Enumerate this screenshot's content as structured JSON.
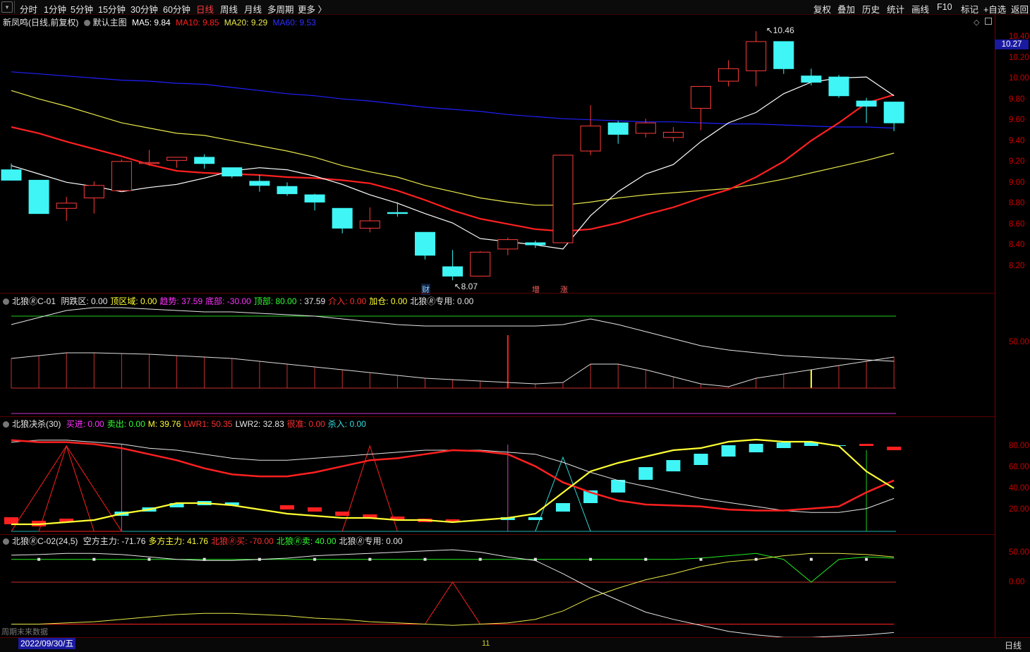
{
  "toolbar": {
    "periods": [
      "分时",
      "1分钟",
      "5分钟",
      "15分钟",
      "30分钟",
      "60分钟",
      "日线",
      "周线",
      "月线",
      "多周期",
      "更多 〉"
    ],
    "active": "日线",
    "right_buttons": [
      "复权",
      "叠加",
      "历史",
      "统计",
      "画线",
      "F10",
      "标记",
      "+自选",
      "返回"
    ]
  },
  "main_legend": {
    "title": "新凤鸣(日线,前复权)",
    "layer": "默认主图",
    "ma5": "MA5: 9.84",
    "ma10": "MA10: 9.85",
    "ma20": "MA20: 9.29",
    "ma60": "MA60: 9.53"
  },
  "price_axis": [
    "10.40",
    "10.20",
    "10.00",
    "9.80",
    "9.60",
    "9.40",
    "9.20",
    "9.00",
    "8.80",
    "8.60",
    "8.40",
    "8.20"
  ],
  "price_axis_range": [
    8.07,
    10.46
  ],
  "last_price": "10.27",
  "high_label": "10.46",
  "low_label": "8.07",
  "events": [
    "财",
    "增",
    "涨"
  ],
  "candles": [
    {
      "o": 9.13,
      "h": 9.19,
      "l": 9.04,
      "c": 9.03
    },
    {
      "o": 9.03,
      "h": 9.03,
      "l": 8.71,
      "c": 8.71
    },
    {
      "o": 8.76,
      "h": 8.87,
      "l": 8.64,
      "c": 8.81
    },
    {
      "o": 8.86,
      "h": 9.02,
      "l": 8.71,
      "c": 8.98
    },
    {
      "o": 8.93,
      "h": 9.23,
      "l": 8.92,
      "c": 9.21
    },
    {
      "o": 9.2,
      "h": 9.32,
      "l": 9.17,
      "c": 9.2
    },
    {
      "o": 9.22,
      "h": 9.25,
      "l": 9.15,
      "c": 9.25
    },
    {
      "o": 9.25,
      "h": 9.28,
      "l": 9.14,
      "c": 9.19
    },
    {
      "o": 9.15,
      "h": 9.15,
      "l": 9.05,
      "c": 9.07
    },
    {
      "o": 9.02,
      "h": 9.08,
      "l": 8.92,
      "c": 8.98
    },
    {
      "o": 8.97,
      "h": 9.01,
      "l": 8.88,
      "c": 8.9
    },
    {
      "o": 8.89,
      "h": 8.9,
      "l": 8.74,
      "c": 8.82
    },
    {
      "o": 8.76,
      "h": 8.76,
      "l": 8.52,
      "c": 8.57
    },
    {
      "o": 8.57,
      "h": 8.77,
      "l": 8.53,
      "c": 8.64
    },
    {
      "o": 8.72,
      "h": 8.82,
      "l": 8.68,
      "c": 8.71
    },
    {
      "o": 8.53,
      "h": 8.53,
      "l": 8.27,
      "c": 8.31
    },
    {
      "o": 8.2,
      "h": 8.36,
      "l": 8.07,
      "c": 8.11
    },
    {
      "o": 8.11,
      "h": 8.35,
      "l": 8.11,
      "c": 8.34
    },
    {
      "o": 8.37,
      "h": 8.48,
      "l": 8.31,
      "c": 8.46
    },
    {
      "o": 8.43,
      "h": 8.45,
      "l": 8.38,
      "c": 8.41
    },
    {
      "o": 8.43,
      "h": 9.27,
      "l": 8.43,
      "c": 9.27
    },
    {
      "o": 9.31,
      "h": 9.75,
      "l": 9.27,
      "c": 9.55
    },
    {
      "o": 9.58,
      "h": 9.6,
      "l": 9.38,
      "c": 9.47
    },
    {
      "o": 9.48,
      "h": 9.62,
      "l": 9.44,
      "c": 9.58
    },
    {
      "o": 9.44,
      "h": 9.54,
      "l": 9.4,
      "c": 9.49
    },
    {
      "o": 9.72,
      "h": 9.91,
      "l": 9.51,
      "c": 9.93
    },
    {
      "o": 9.98,
      "h": 10.18,
      "l": 9.93,
      "c": 10.1
    },
    {
      "o": 10.08,
      "h": 10.46,
      "l": 9.93,
      "c": 10.36
    },
    {
      "o": 10.36,
      "h": 10.36,
      "l": 10.05,
      "c": 10.1
    },
    {
      "o": 10.03,
      "h": 10.1,
      "l": 9.94,
      "c": 9.97
    },
    {
      "o": 10.02,
      "h": 10.04,
      "l": 9.82,
      "c": 9.84
    },
    {
      "o": 9.79,
      "h": 9.82,
      "l": 9.58,
      "c": 9.74
    },
    {
      "o": 9.78,
      "h": 9.78,
      "l": 9.5,
      "c": 9.58
    }
  ],
  "ma_lines": {
    "ma5": [
      9.17,
      9.09,
      9.01,
      8.97,
      8.92,
      8.96,
      8.99,
      9.05,
      9.12,
      9.15,
      9.13,
      9.07,
      8.99,
      8.89,
      8.81,
      8.71,
      8.62,
      8.47,
      8.44,
      8.41,
      8.37,
      8.69,
      8.92,
      9.09,
      9.18,
      9.4,
      9.58,
      9.68,
      9.86,
      9.97,
      10.01,
      10.02,
      9.84
    ],
    "ma10": [
      9.54,
      9.48,
      9.4,
      9.33,
      9.26,
      9.18,
      9.12,
      9.1,
      9.09,
      9.08,
      9.06,
      9.05,
      9.03,
      9.0,
      8.93,
      8.84,
      8.74,
      8.66,
      8.61,
      8.56,
      8.54,
      8.56,
      8.62,
      8.7,
      8.77,
      8.86,
      8.94,
      9.06,
      9.21,
      9.41,
      9.58,
      9.77,
      9.85
    ],
    "ma20": [
      9.89,
      9.81,
      9.74,
      9.66,
      9.58,
      9.53,
      9.48,
      9.46,
      9.41,
      9.36,
      9.31,
      9.25,
      9.17,
      9.11,
      9.06,
      8.98,
      8.92,
      8.86,
      8.82,
      8.79,
      8.79,
      8.82,
      8.86,
      8.89,
      8.91,
      8.93,
      8.95,
      8.99,
      9.04,
      9.1,
      9.16,
      9.22,
      9.29
    ],
    "ma60": [
      10.07,
      10.05,
      10.03,
      10.01,
      9.99,
      9.98,
      9.96,
      9.95,
      9.92,
      9.89,
      9.86,
      9.84,
      9.81,
      9.79,
      9.76,
      9.73,
      9.71,
      9.69,
      9.66,
      9.64,
      9.62,
      9.61,
      9.6,
      9.59,
      9.59,
      9.58,
      9.57,
      9.57,
      9.56,
      9.55,
      9.54,
      9.54,
      9.53
    ]
  },
  "ind1": {
    "name": "北狼🄬C-01",
    "items": [
      {
        "t": "阴跌区: 0.00",
        "c": "#e6e6e6"
      },
      {
        "t": "顶区域: 0.00",
        "c": "#ffff33"
      },
      {
        "t": "趋势: 37.59",
        "c": "#ff33ff"
      },
      {
        "t": "底部: -30.00",
        "c": "#ff33ff"
      },
      {
        "t": "顶部: 80.00",
        "c": "#33ff33"
      },
      {
        "t": ": 37.59",
        "c": "#e6e6e6"
      },
      {
        "t": "介入: 0.00",
        "c": "#ff3030"
      },
      {
        "t": "加仓: 0.00",
        "c": "#ffff33"
      },
      {
        "t": "北狼🄬专用: 0.00",
        "c": "#e6e6e6"
      }
    ],
    "axis": [
      "50.00"
    ]
  },
  "ind2": {
    "name": "北狼决杀(30)",
    "items": [
      {
        "t": "买进: 0.00",
        "c": "#ff33ff"
      },
      {
        "t": "卖出: 0.00",
        "c": "#33ff33"
      },
      {
        "t": "M: 39.76",
        "c": "#ffff33"
      },
      {
        "t": "LWR1: 50.35",
        "c": "#ff3030"
      },
      {
        "t": "LWR2: 32.83",
        "c": "#e6e6e6"
      },
      {
        "t": "很准: 0.00",
        "c": "#ff3030"
      },
      {
        "t": "杀入: 0.00",
        "c": "#33dddd"
      }
    ],
    "axis": [
      "80.00",
      "60.00",
      "40.00",
      "20.00"
    ]
  },
  "ind3": {
    "name": "北狼🄬C-02(24,5)",
    "items": [
      {
        "t": "空方主力: -71.76",
        "c": "#e6e6e6"
      },
      {
        "t": "多方主力: 41.76",
        "c": "#ffff33"
      },
      {
        "t": "北狼🄬买: -70.00",
        "c": "#ff3030"
      },
      {
        "t": "北狼🄬卖: 40.00",
        "c": "#33ff33"
      },
      {
        "t": "北狼🄬专用: 0.00",
        "c": "#e6e6e6"
      }
    ],
    "axis": [
      "50.00",
      "0.00"
    ]
  },
  "footer": {
    "date": "2022/09/30/五",
    "month_tick": "11",
    "period": "日线",
    "note": "周期末来数据"
  },
  "colors": {
    "up": "#ff3b3b",
    "down": "#3ff5f5",
    "ma5": "#ffffff",
    "ma10": "#ff2020",
    "ma20": "#e8e84a",
    "ma60": "#2020ff"
  }
}
